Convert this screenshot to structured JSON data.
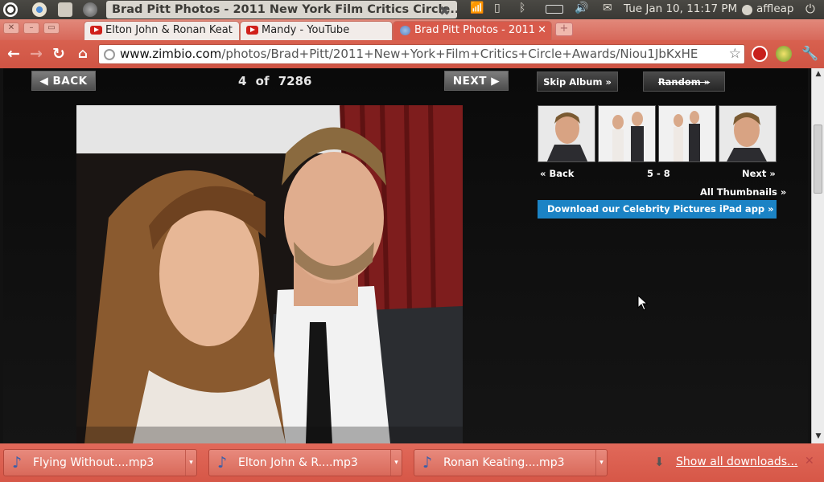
{
  "system_panel": {
    "window_title": "Brad Pitt Photos - 2011 New York Film Critics Circle...",
    "clock": "Tue Jan 10, 11:17 PM",
    "user": "affleap"
  },
  "tabs": [
    {
      "label": "Elton John & Ronan Keat",
      "favicon": "youtube-icon",
      "active": false
    },
    {
      "label": "Mandy - YouTube",
      "favicon": "youtube-icon",
      "active": false
    },
    {
      "label": "Brad Pitt Photos - 2011",
      "favicon": "zimbio-icon",
      "active": true
    }
  ],
  "address_bar": {
    "host": "www.zimbio.com",
    "path": "/photos/Brad+Pitt/2011+New+York+Film+Critics+Circle+Awards/Niou1JbKxHE"
  },
  "gallery": {
    "back_label": "BACK",
    "next_label": "NEXT",
    "current": "4",
    "of_label": "of",
    "total": "7286",
    "skip_album_label": "Skip Album »",
    "random_label": "Random »",
    "thumb_back_label": "Back",
    "thumb_range": "5 - 8",
    "thumb_next_label": "Next",
    "all_thumbnails_label": "All Thumbnails »",
    "ipad_label": "Download our Celebrity Pictures iPad app »"
  },
  "downloads": {
    "items": [
      {
        "label": "Flying Without....mp3"
      },
      {
        "label": "Elton John & R....mp3"
      },
      {
        "label": "Ronan Keating....mp3"
      }
    ],
    "show_all_label": "Show all downloads..."
  },
  "colors": {
    "chrome_red": "#d85a4b",
    "ipad_blue": "#1b83c5",
    "page_bg": "#121212"
  }
}
